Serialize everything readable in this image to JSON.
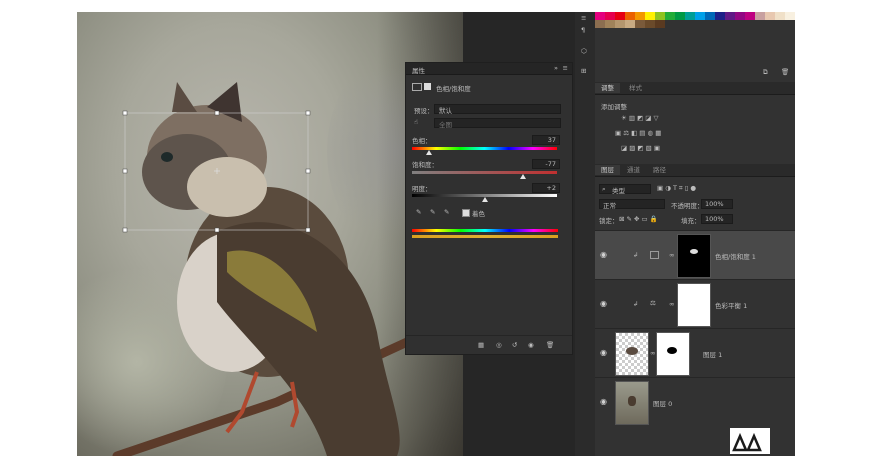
{
  "properties": {
    "title": "属性",
    "adjustment_name": "色相/饱和度",
    "preset_label": "预设：",
    "preset_value": "默认",
    "channel_value": "全图",
    "hue_label": "色相：",
    "hue_value": "37",
    "saturation_label": "饱和度：",
    "saturation_value": "-77",
    "lightness_label": "明度：",
    "lightness_value": "+2",
    "colorize_label": "着色"
  },
  "adjustments": {
    "tab_adjust": "调整",
    "tab_style": "样式",
    "add_label": "添加调整"
  },
  "layers": {
    "tab_layers": "图层",
    "tab_channels": "通道",
    "tab_paths": "路径",
    "kind_filter": "类型",
    "blend_mode": "正常",
    "opacity_label": "不透明度：",
    "opacity_value": "100%",
    "lock_label": "锁定：",
    "fill_label": "填充：",
    "fill_value": "100%",
    "items": [
      {
        "name": "色相/饱和度 1"
      },
      {
        "name": "色彩平衡 1"
      },
      {
        "name": "图层 1"
      },
      {
        "name": "图层 0"
      }
    ]
  },
  "colors": {
    "panel_bg": "#323232",
    "selected_layer": "#494949",
    "accent": "#2d8ceb"
  },
  "icons": [
    "eye-icon",
    "link-icon",
    "clip-arrow-icon",
    "eyedropper-icon",
    "trash-icon",
    "reset-icon",
    "visibility-icon",
    "search-icon"
  ]
}
